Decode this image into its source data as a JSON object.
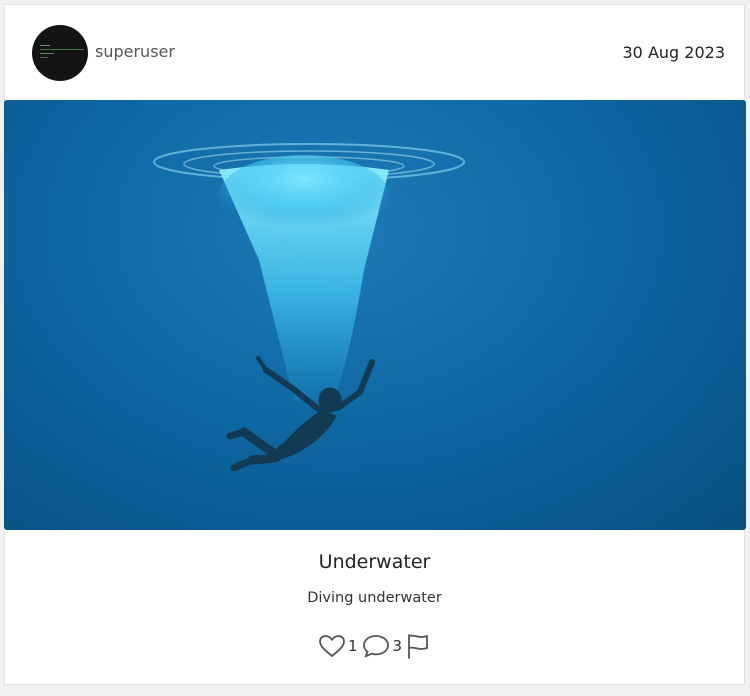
{
  "post": {
    "author": {
      "username": "superuser",
      "avatar_icon": "terminal-avatar-icon"
    },
    "date": "30 Aug 2023",
    "image": {
      "description_icon": "underwater-diver-image",
      "palette": {
        "water": "#0f6aa6",
        "bubbles": "#4fd0f5"
      }
    },
    "title": "Underwater",
    "description": "Diving underwater",
    "stats": {
      "likes": "1",
      "comments": "3"
    },
    "icons": {
      "like": "heart-icon",
      "comment": "speech-bubble-icon",
      "report": "flag-icon"
    }
  }
}
